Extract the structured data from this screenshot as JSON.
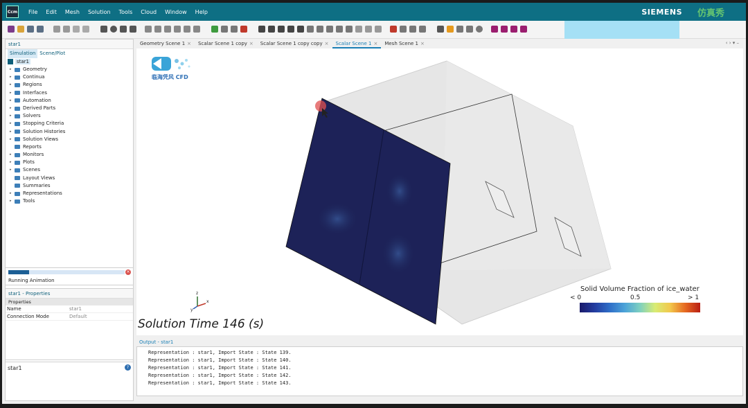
{
  "app": {
    "logo_text": "Ccm",
    "brand": "SIEMENS",
    "watermark": "仿真秀",
    "menu": [
      "File",
      "Edit",
      "Mesh",
      "Solution",
      "Tools",
      "Cloud",
      "Window",
      "Help"
    ]
  },
  "left": {
    "tab": "star1",
    "subtabs": [
      "Simulation",
      "Scene/Plot"
    ],
    "root": "star1",
    "tree": [
      {
        "label": "Geometry",
        "expandable": true
      },
      {
        "label": "Continua",
        "expandable": true
      },
      {
        "label": "Regions",
        "expandable": true
      },
      {
        "label": "Interfaces",
        "expandable": true
      },
      {
        "label": "Automation",
        "expandable": true
      },
      {
        "label": "Derived Parts",
        "expandable": true
      },
      {
        "label": "Solvers",
        "expandable": true
      },
      {
        "label": "Stopping Criteria",
        "expandable": true
      },
      {
        "label": "Solution Histories",
        "expandable": true
      },
      {
        "label": "Solution Views",
        "expandable": true
      },
      {
        "label": "Reports",
        "expandable": false
      },
      {
        "label": "Monitors",
        "expandable": true
      },
      {
        "label": "Plots",
        "expandable": true
      },
      {
        "label": "Scenes",
        "expandable": true
      },
      {
        "label": "Layout Views",
        "expandable": false
      },
      {
        "label": "Summaries",
        "expandable": false
      },
      {
        "label": "Representations",
        "expandable": true
      },
      {
        "label": "Tools",
        "expandable": true
      }
    ],
    "progress_label": "Running Animation",
    "progress_fraction": 0.18,
    "properties_tab": "star1 - Properties",
    "properties_header": "Properties",
    "properties": [
      {
        "key": "Name",
        "value": "star1"
      },
      {
        "key": "Connection Mode",
        "value": "Default"
      }
    ],
    "description_title": "star1"
  },
  "scene_tabs": [
    {
      "label": "Geometry Scene 1",
      "active": false
    },
    {
      "label": "Scalar Scene 1 copy",
      "active": false
    },
    {
      "label": "Scalar Scene 1 copy copy",
      "active": false
    },
    {
      "label": "Scalar Scene 1",
      "active": true
    },
    {
      "label": "Mesh Scene 1",
      "active": false
    }
  ],
  "scene": {
    "cfd_logo_text": "临海凭风 CFD",
    "solution_time": "Solution Time 146 (s)",
    "legend": {
      "title": "Solid Volume Fraction of ice_water",
      "min_label": "< 0",
      "mid_label": "0.5",
      "max_label": "> 1",
      "colors": [
        "#1a1a6a",
        "#233ca0",
        "#2f6fc8",
        "#4ca3d8",
        "#7ed0c0",
        "#d8ec74",
        "#f2c84c",
        "#e66a22",
        "#b91e13"
      ]
    },
    "axes": {
      "x": "x",
      "y": "y",
      "z": "z"
    }
  },
  "output": {
    "tab": "Output - star1",
    "lines": [
      "Representation : star1, Import State : State 139.",
      "Representation : star1, Import State : State 140.",
      "Representation : star1, Import State : State 141.",
      "Representation : star1, Import State : State 142.",
      "Representation : star1, Import State : State 143."
    ]
  }
}
